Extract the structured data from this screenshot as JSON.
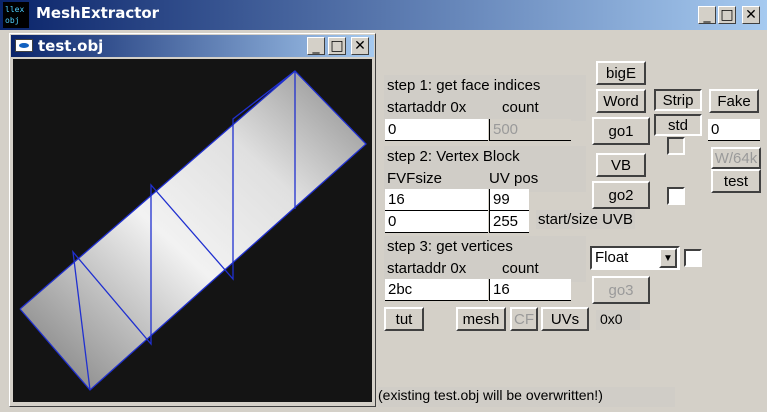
{
  "app": {
    "title": "MeshExtractor",
    "icon_text": "llex obj"
  },
  "child": {
    "title": "test.obj"
  },
  "step1": {
    "title": "step 1: get face indices",
    "startaddr_label": "startaddr 0x",
    "count_label": "count",
    "startaddr_value": "0",
    "count_value": "500"
  },
  "step2": {
    "title": "step 2: Vertex Block",
    "fvf_label": "FVFsize",
    "uvpos_label": "UV pos",
    "fvf_value": "16",
    "uvpos_value": "99",
    "start_value": "0",
    "size_value": "255",
    "startsize_label": "start/size UVB"
  },
  "step3": {
    "title": "step 3: get vertices",
    "startaddr_label": "startaddr 0x",
    "count_label": "count",
    "startaddr_value": "2bc",
    "count_value": "16",
    "format_selected": "Float"
  },
  "buttons": {
    "bigE": "bigE",
    "word": "Word",
    "strip": "Strip",
    "fake": "Fake",
    "go1": "go1",
    "std": "std",
    "fake_value": "0",
    "vb": "VB",
    "w64k": "W/64k",
    "test": "test",
    "go2": "go2",
    "go3": "go3",
    "tut": "tut",
    "mesh": "mesh",
    "cf": "CF",
    "uvs": "UVs",
    "dims": "0x0"
  },
  "status": {
    "message": "(existing test.obj will be overwritten!)"
  },
  "window_controls": {
    "minimize": "_",
    "maximize": "□",
    "close": "✕"
  }
}
